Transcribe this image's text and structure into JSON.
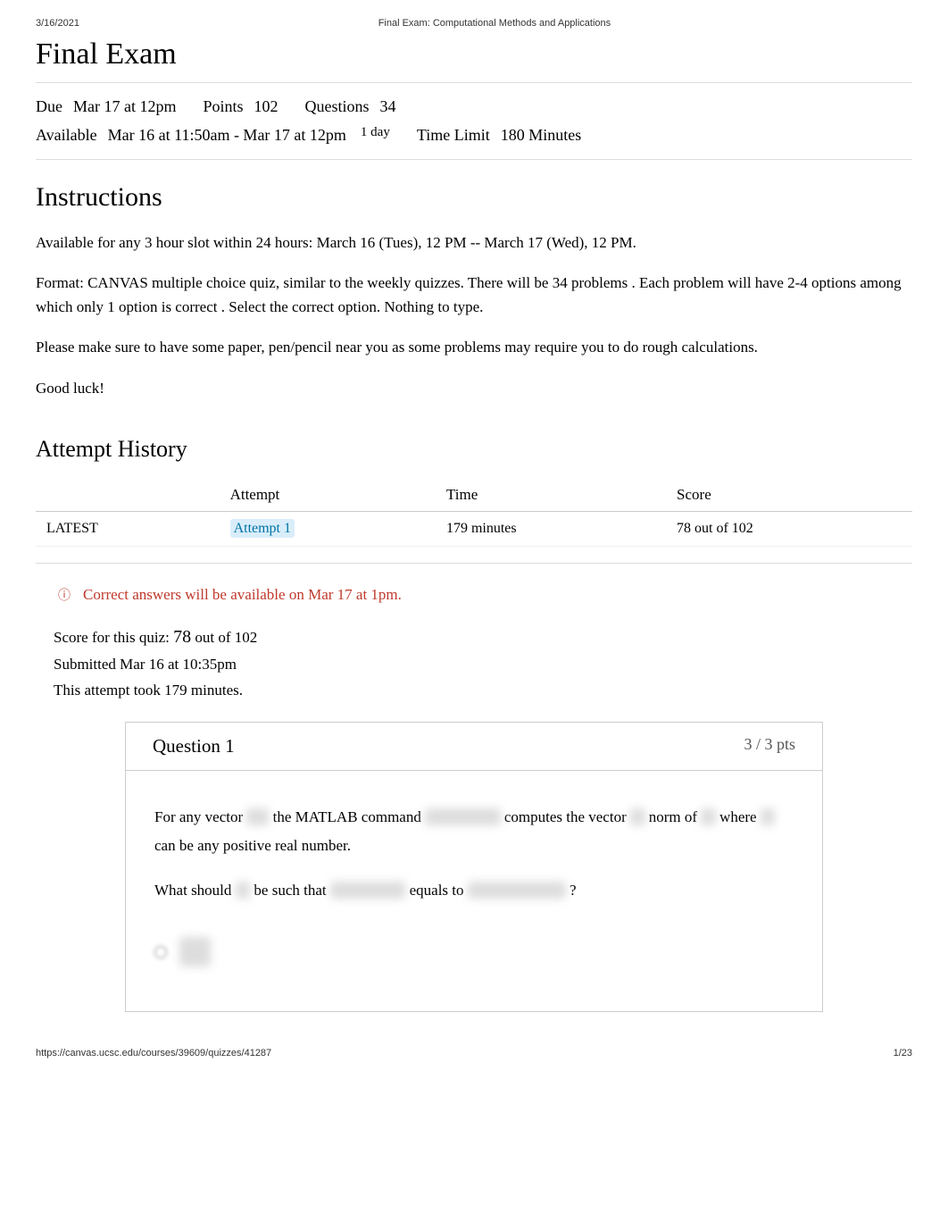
{
  "header": {
    "date": "3/16/2021",
    "doc_title": "Final Exam: Computational Methods and Applications"
  },
  "title": "Final Exam",
  "meta": {
    "due_label": "Due",
    "due_value": "Mar 17 at 12pm",
    "points_label": "Points",
    "points_value": "102",
    "questions_label": "Questions",
    "questions_value": "34",
    "available_label": "Available",
    "available_value": "Mar 16 at 11:50am - Mar 17 at 12pm",
    "available_sub": "1 day",
    "time_limit_label": "Time Limit",
    "time_limit_value": "180 Minutes"
  },
  "instructions": {
    "heading": "Instructions",
    "p1": "Available for any 3 hour slot within 24 hours: March 16 (Tues), 12 PM -- March 17 (Wed), 12 PM.",
    "p2a": "Format: CANVAS multiple choice quiz, similar to the weekly quizzes. There will be ",
    "p2b": "34 problems",
    "p2c": ". Each problem will have 2-4 options among which ",
    "p2d": "only 1 option is correct",
    "p2e": ". Select the correct option. Nothing to type.",
    "p3": "Please make sure to have some paper, pen/pencil near you as some problems may require you to do rough calculations.",
    "p4": "Good luck!"
  },
  "attempt_history": {
    "heading": "Attempt History",
    "cols": {
      "c1": "",
      "c2": "Attempt",
      "c3": "Time",
      "c4": "Score"
    },
    "row": {
      "status": "LATEST",
      "attempt_link": "Attempt 1",
      "time": "179 minutes",
      "score": "78 out of 102"
    }
  },
  "notice_text": "Correct answers will be available on Mar 17 at 1pm.",
  "score_summary": {
    "line1a": "Score for this quiz: ",
    "line1b": "78",
    "line1c": " out of 102",
    "line2": "Submitted Mar 16 at 10:35pm",
    "line3": "This attempt took 179 minutes."
  },
  "question1": {
    "title": "Question 1",
    "pts": "3 / 3 pts",
    "line1a": "For any vector ",
    "line1b": " the MATLAB command ",
    "line1c": " computes the vector ",
    "line1d": " norm of ",
    "line1e": " where ",
    "line1f": " can be any positive real number.",
    "line2a": "What should ",
    "line2b": " be such that ",
    "line2c": " equals to ",
    "line2d": " ?",
    "option1": "p=0"
  },
  "footer": {
    "url": "https://canvas.ucsc.edu/courses/39609/quizzes/41287",
    "page": "1/23"
  }
}
